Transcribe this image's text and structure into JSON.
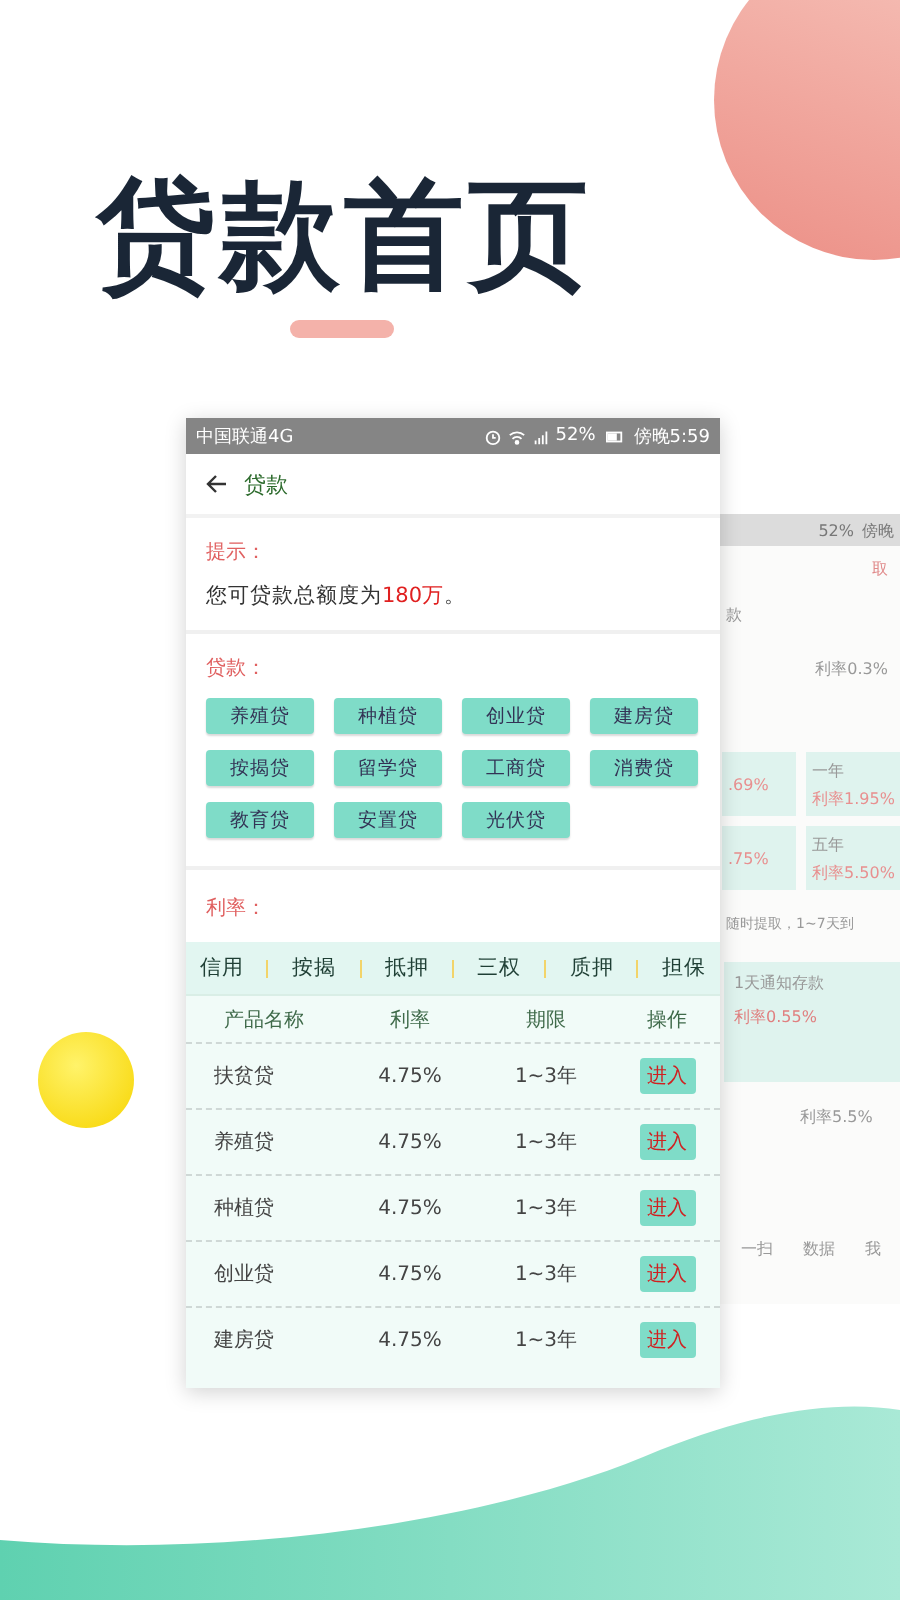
{
  "hero": {
    "title": "贷款首页"
  },
  "status_bar": {
    "carrier": "中国联通4G",
    "battery": "52%",
    "time": "傍晚5:59"
  },
  "header": {
    "title": "贷款"
  },
  "notice": {
    "label": "提示：",
    "text_before": "您可贷款总额度为",
    "amount": "180万",
    "text_after": "。"
  },
  "loans": {
    "label": "贷款：",
    "items": [
      "养殖贷",
      "种植贷",
      "创业贷",
      "建房贷",
      "按揭贷",
      "留学贷",
      "工商贷",
      "消费贷",
      "教育贷",
      "安置贷",
      "光伏贷"
    ]
  },
  "rates": {
    "label": "利率：",
    "tabs": [
      "信用",
      "按揭",
      "抵押",
      "三权",
      "质押",
      "担保"
    ],
    "columns": [
      "产品名称",
      "利率",
      "期限",
      "操作"
    ],
    "rows": [
      {
        "name": "扶贫贷",
        "rate": "4.75%",
        "term": "1~3年",
        "action": "进入"
      },
      {
        "name": "养殖贷",
        "rate": "4.75%",
        "term": "1~3年",
        "action": "进入"
      },
      {
        "name": "种植贷",
        "rate": "4.75%",
        "term": "1~3年",
        "action": "进入"
      },
      {
        "name": "创业贷",
        "rate": "4.75%",
        "term": "1~3年",
        "action": "进入"
      },
      {
        "name": "建房贷",
        "rate": "4.75%",
        "term": "1~3年",
        "action": "进入"
      }
    ]
  },
  "background_screen": {
    "battery": "52%",
    "time": "傍晚",
    "action": "取",
    "tab": "款",
    "rate_note": "利率0.3%",
    "tiles": [
      {
        "rate": ".69%"
      },
      {
        "title": "一年",
        "rate": "利率1.95%"
      },
      {
        "rate": ".75%"
      },
      {
        "title": "五年",
        "rate": "利率5.50%"
      }
    ],
    "notice": "随时提取，1~7天到",
    "deposit": {
      "title": "1天通知存款",
      "rate": "利率0.55%"
    },
    "rate_note_2": "利率5.5%",
    "nav": [
      "一扫",
      "数据",
      "我"
    ]
  }
}
